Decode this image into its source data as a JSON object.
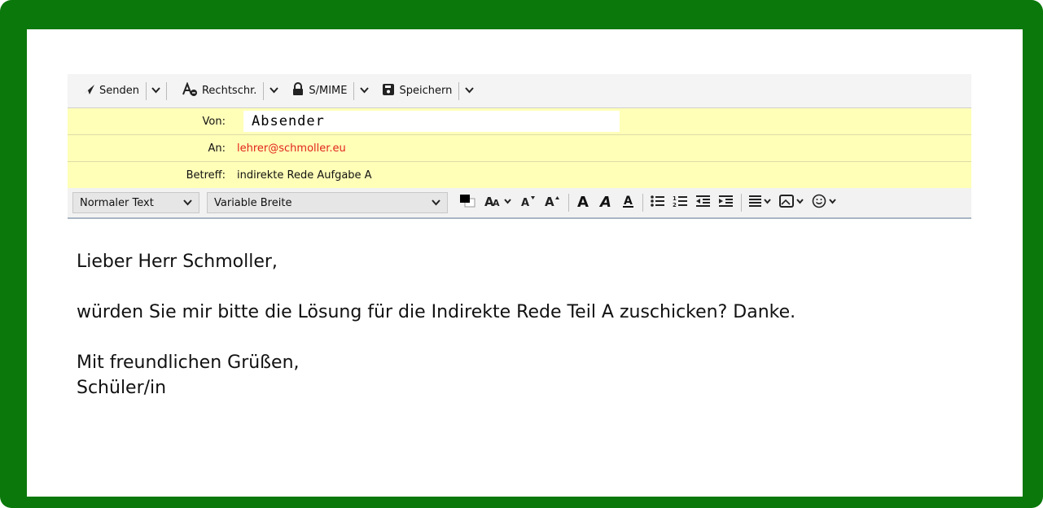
{
  "toolbar": {
    "send_label": "Senden",
    "spell_label": "Rechtschr.",
    "smime_label": "S/MIME",
    "save_label": "Speichern"
  },
  "headers": {
    "from_label": "Von:",
    "from_value": "Absender",
    "to_label": "An:",
    "to_value": "lehrer@schmoller.eu",
    "subject_label": "Betreff:",
    "subject_value": "indirekte Rede Aufgabe A"
  },
  "format": {
    "paragraph_style": "Normaler Text",
    "font": "Variable Breite"
  },
  "body": {
    "greeting": "Lieber Herr Schmoller,",
    "line1": "würden Sie mir bitte die Lösung für die Indirekte Rede Teil A zuschicken? Danke.",
    "closing": "Mit freundlichen Grüßen,",
    "signature": "Schüler/in"
  },
  "colors": {
    "frame": "#0a780a",
    "header_bg": "#ffffb8",
    "recipient": "#e2231a"
  }
}
